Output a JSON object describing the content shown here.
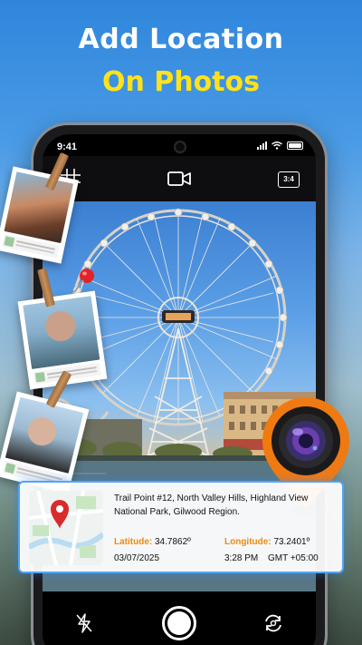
{
  "headline": {
    "line1": "Add Location",
    "line2": "On Photos"
  },
  "status_bar": {
    "time": "9:41"
  },
  "camera_toolbar": {
    "grid_icon": "grid-icon",
    "video_icon": "video-camera-icon",
    "ratio_label": "3:4"
  },
  "camera_controls": {
    "flash_icon": "flash-off-icon",
    "shutter_icon": "shutter-button",
    "flip_icon": "flip-camera-icon"
  },
  "location_card": {
    "address": "Trail Point #12, North Valley Hills, Highland View National Park, Gilwood Region.",
    "latitude_label": "Latitude:",
    "latitude_value": "34.7862º",
    "longitude_label": "Longitude:",
    "longitude_value": "73.2401º",
    "date": "03/07/2025",
    "time": "3:28 PM",
    "timezone": "GMT +05:00"
  },
  "colors": {
    "headline_white": "#ffffff",
    "headline_yellow": "#ffe21a",
    "accent_orange": "#ee8a12",
    "card_border": "#53a4f4",
    "pin_orange": "#f07a12"
  }
}
